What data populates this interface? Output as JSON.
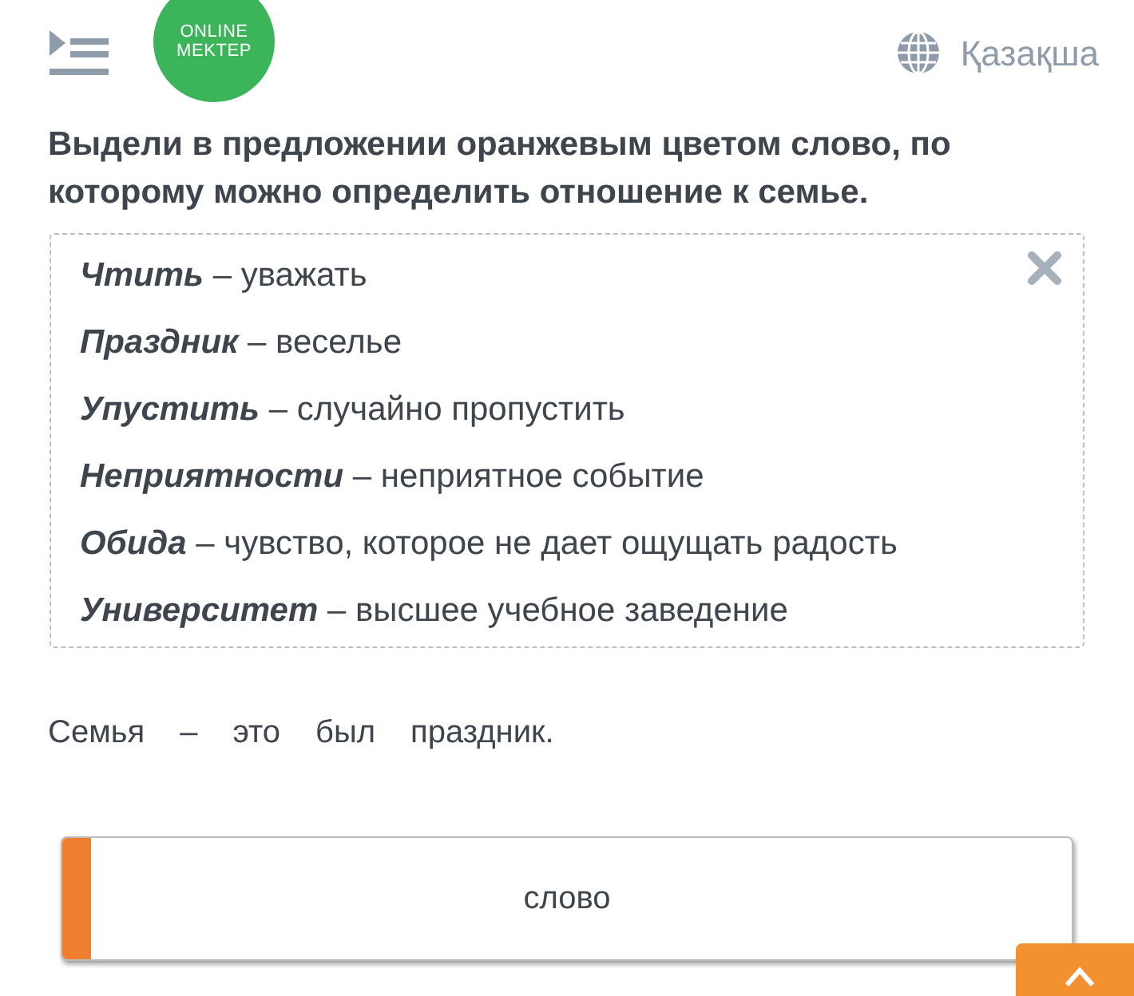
{
  "header": {
    "logo": [
      "ONLINE",
      "MEKTEP"
    ],
    "language": "Қазақша"
  },
  "task": "Выдели в предложении оранжевым цветом слово, по которому можно определить отношение к семье.",
  "glossary": [
    {
      "term": "Чтить",
      "definition": "– уважать"
    },
    {
      "term": "Праздник",
      "definition": "– веселье"
    },
    {
      "term": "Упустить",
      "definition": "– случайно пропустить"
    },
    {
      "term": "Неприятности",
      "definition": "– неприятное событие"
    },
    {
      "term": "Обида",
      "definition": "– чувство, которое не дает ощущать радость"
    },
    {
      "term": "Университет",
      "definition": "– высшее учебное заведение"
    }
  ],
  "sentence": [
    {
      "word": "Семья",
      "selected": false
    },
    {
      "word": "–",
      "selected": false
    },
    {
      "word": "это",
      "selected": false
    },
    {
      "word": "был",
      "selected": false
    },
    {
      "word": "праздник.",
      "selected": false
    }
  ],
  "answer_card": {
    "text": "слово",
    "color": "#f07f32"
  }
}
